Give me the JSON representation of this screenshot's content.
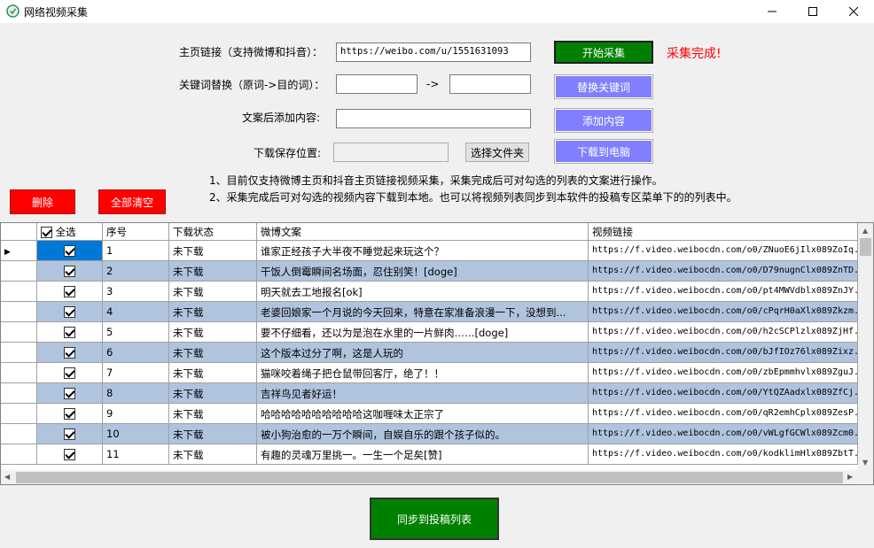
{
  "window": {
    "title": "网络视频采集"
  },
  "form": {
    "url_label": "主页链接（支持微博和抖音）：",
    "url_value": "https://weibo.com/u/1551631093",
    "keyword_label": "关键词替换（原词->目的词）：",
    "keyword_from": "",
    "keyword_arrow": "->",
    "keyword_to": "",
    "append_label": "文案后添加内容:",
    "append_value": "",
    "save_label": "下载保存位置:",
    "save_value": "",
    "choose_folder": "选择文件夹"
  },
  "actions": {
    "start": "开始采集",
    "replace": "替换关键词",
    "add": "添加内容",
    "download": "下载到电脑",
    "delete": "删除",
    "clear_all": "全部清空",
    "sync": "同步到投稿列表"
  },
  "status": "采集完成!",
  "notes": [
    "1、目前仅支持微博主页和抖音主页链接视频采集，采集完成后可对勾选的列表的文案进行操作。",
    "2、采集完成后可对勾选的视频内容下载到本地。也可以将视频列表同步到本软件的投稿专区菜单下的的列表中。"
  ],
  "table": {
    "headers": {
      "select_all": "全选",
      "index": "序号",
      "status": "下载状态",
      "caption": "微博文案",
      "link": "视频链接"
    },
    "rows": [
      {
        "index": "1",
        "status": "未下载",
        "caption": "谁家正经孩子大半夜不睡觉起来玩这个？",
        "link": "https://f.video.weibocdn.com/o0/ZNuoE6jIlx089ZoIq."
      },
      {
        "index": "2",
        "status": "未下载",
        "caption": "干饭人倒霉瞬间名场面，忍住别笑！[doge]",
        "link": "https://f.video.weibocdn.com/o0/D79nugnClx089ZnTD."
      },
      {
        "index": "3",
        "status": "未下载",
        "caption": "明天就去工地报名[ok]",
        "link": "https://f.video.weibocdn.com/o0/pt4MWVdblx089ZnJY."
      },
      {
        "index": "4",
        "status": "未下载",
        "caption": "老婆回娘家一个月说的今天回来，特意在家准备浪漫一下，没想到...",
        "link": "https://f.video.weibocdn.com/o0/cPqrH0aXlx089Zkzm."
      },
      {
        "index": "5",
        "status": "未下载",
        "caption": "要不仔细看，还以为是泡在水里的一片鲜肉……[doge]",
        "link": "https://f.video.weibocdn.com/o0/h2cSCPlzlx089ZjHf."
      },
      {
        "index": "6",
        "status": "未下载",
        "caption": "这个版本过分了啊，这是人玩的",
        "link": "https://f.video.weibocdn.com/o0/bJfIOz76lx089Zixz."
      },
      {
        "index": "7",
        "status": "未下载",
        "caption": "猫咪咬着绳子把仓鼠带回客厅，绝了！！",
        "link": "https://f.video.weibocdn.com/o0/zbEpmmhvlx089ZguJ."
      },
      {
        "index": "8",
        "status": "未下载",
        "caption": "吉祥鸟见者好运！",
        "link": "https://f.video.weibocdn.com/o0/YtQZAadxlx089ZfCj."
      },
      {
        "index": "9",
        "status": "未下载",
        "caption": "哈哈哈哈哈哈哈哈哈哈这咖喱味太正宗了",
        "link": "https://f.video.weibocdn.com/o0/qR2emhCplx089ZesP."
      },
      {
        "index": "10",
        "status": "未下载",
        "caption": "被小狗治愈的一万个瞬间，自娱自乐的跟个孩子似的。",
        "link": "https://f.video.weibocdn.com/o0/vWLgfGCWlx089Zcm0."
      },
      {
        "index": "11",
        "status": "未下载",
        "caption": "有趣的灵魂万里挑一。一生一个足矣[赞]",
        "link": "https://f.video.weibocdn.com/o0/kodklimHlx089ZbtT."
      }
    ]
  },
  "colors": {
    "green": "#008000",
    "purple": "#8080ff",
    "red": "#ff0000",
    "row_alt": "#b0c4de",
    "selected": "#0078d7"
  }
}
